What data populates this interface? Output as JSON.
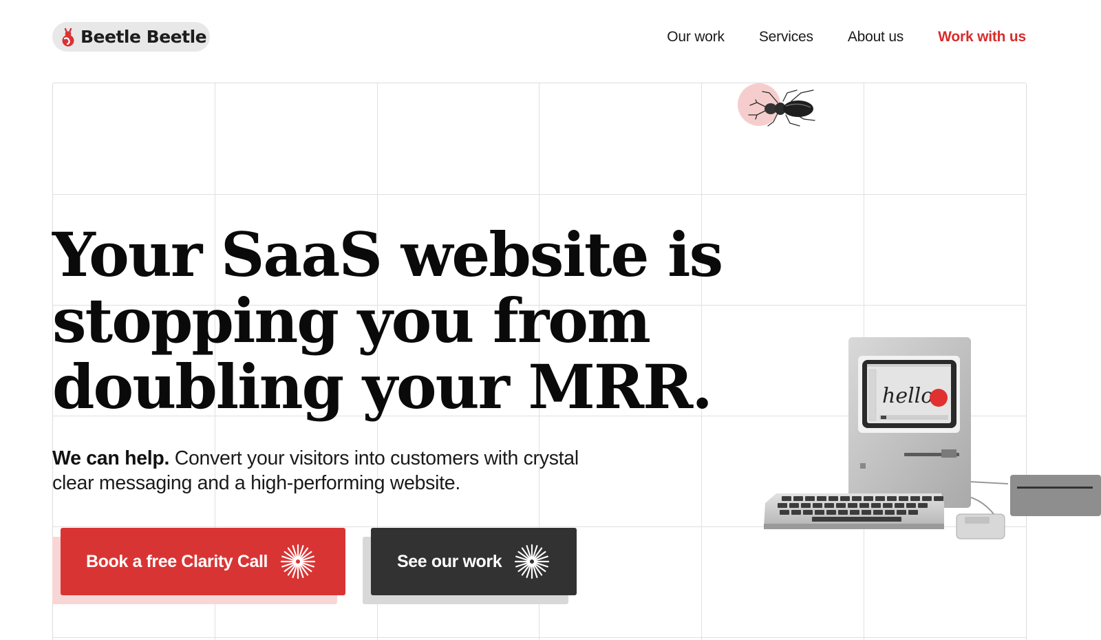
{
  "brand": {
    "name": "Beetle Beetle",
    "accent_color": "#d93434",
    "icon": "beetle-logo-icon"
  },
  "nav": {
    "items": [
      {
        "label": "Our work",
        "highlight": false
      },
      {
        "label": "Services",
        "highlight": false
      },
      {
        "label": "About us",
        "highlight": false
      },
      {
        "label": "Work with us",
        "highlight": true
      }
    ]
  },
  "hero": {
    "headline_lines": [
      "Your SaaS website is",
      "stopping you from",
      "doubling your MRR."
    ],
    "subheading_bold": "We can help.",
    "subheading_rest": " Convert your visitors into customers with crystal clear messaging and a high-performing website.",
    "primary_button": {
      "label": "Book a free Clarity Call",
      "icon": "starburst-icon",
      "color": "#d93434"
    },
    "secondary_button": {
      "label": "See our work",
      "icon": "starburst-icon",
      "color": "#323232"
    },
    "illustration": {
      "screen_text": "hello",
      "decorations": [
        "stag-beetle-image",
        "macintosh-computer-image"
      ]
    }
  }
}
